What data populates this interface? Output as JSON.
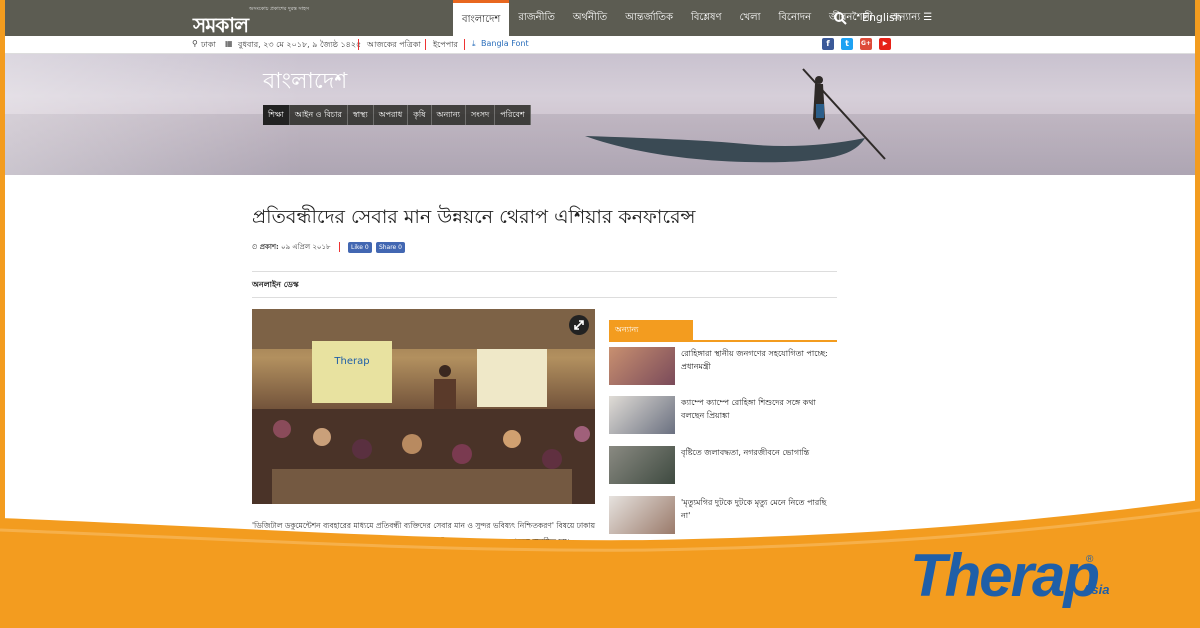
{
  "topnav": {
    "logo_tagline": "অসংকোচ প্রকাশের দুরন্ত সাহস",
    "logo_name": "সমকাল",
    "items": [
      {
        "label": "বাংলাদেশ"
      },
      {
        "label": "রাজনীতি"
      },
      {
        "label": "অর্থনীতি"
      },
      {
        "label": "আন্তর্জাতিক"
      },
      {
        "label": "বিশ্লেষণ"
      },
      {
        "label": "খেলা"
      },
      {
        "label": "বিনোদন"
      },
      {
        "label": "জীবনশৈলী"
      },
      {
        "label": "অন্যান্য ☰"
      }
    ],
    "english": "English"
  },
  "infobar": {
    "location": "ঢাকা",
    "date": "বুধবার, ২৩ মে ২০১৮,  ৯ জ্যৈষ্ঠ ১৪২৫",
    "todays_paper": "আজকের পত্রিকা",
    "epaper": "ইপেপার",
    "bangla_font": "Bangla Font"
  },
  "hero": {
    "section_title": "বাংলাদেশ",
    "subnav": [
      "শিক্ষা",
      "আইন ও বিচার",
      "স্বাস্থ্য",
      "অপরাধ",
      "কৃষি",
      "অন্যান্য",
      "সংসদ",
      "পরিবেশ"
    ]
  },
  "article": {
    "headline": "প্রতিবন্ধীদের সেবার মান উন্নয়নে থেরাপ এশিয়ার কনফারেন্স",
    "published_label": "প্রকাশ:",
    "published_date": "০৯ এপ্রিল ২০১৮",
    "like_label": "Like 0",
    "share_label": "Share 0",
    "byline": "অনলাইন ডেস্ক",
    "body": "'ডিজিটাল ডকুমেন্টেশন ব্যবহারের মাধ্যমে প্রতিবন্ধী ব্যক্তিদের সেবার মান ও সুন্দর ভবিষ্যৎ নিশ্চিতকরণ' বিষয়ে ঢাকায় দ্বিতীয় বার্ষিক কনফারেন্স করেছে থেরাপ এশিয়া। রোববার রাজধানীর রাওয়া ক্লাবে এ কনফারেন্স অনুষ্ঠিত হয়।"
  },
  "sidebar": {
    "tab": "অন্যান্য",
    "items": [
      {
        "text": "রোহিঙ্গারা স্থানীয় জনগণের সহযোগিতা পাচ্ছে: প্রধানমন্ত্রী"
      },
      {
        "text": "ক্যাম্পে ক্যাম্পে রোহিঙ্গা শিশুদের সঙ্গে কথা বলছেন প্রিয়াঙ্কা"
      },
      {
        "text": "বৃষ্টিতে জলাবদ্ধতা, নগরজীবনে ভোগান্তি"
      },
      {
        "text": "'মৃত্যুমগির দুটকে দুটকে মৃত্যু মেনে নিতে পারছি না'"
      }
    ]
  },
  "brand": {
    "name": "Therap",
    "suffix": "Asia",
    "registered": "®",
    "photo_logo": "Therap"
  },
  "colors": {
    "orange": "#f39c1f",
    "navbar": "#5c5c52",
    "therap_blue": "#1f5fa8"
  }
}
